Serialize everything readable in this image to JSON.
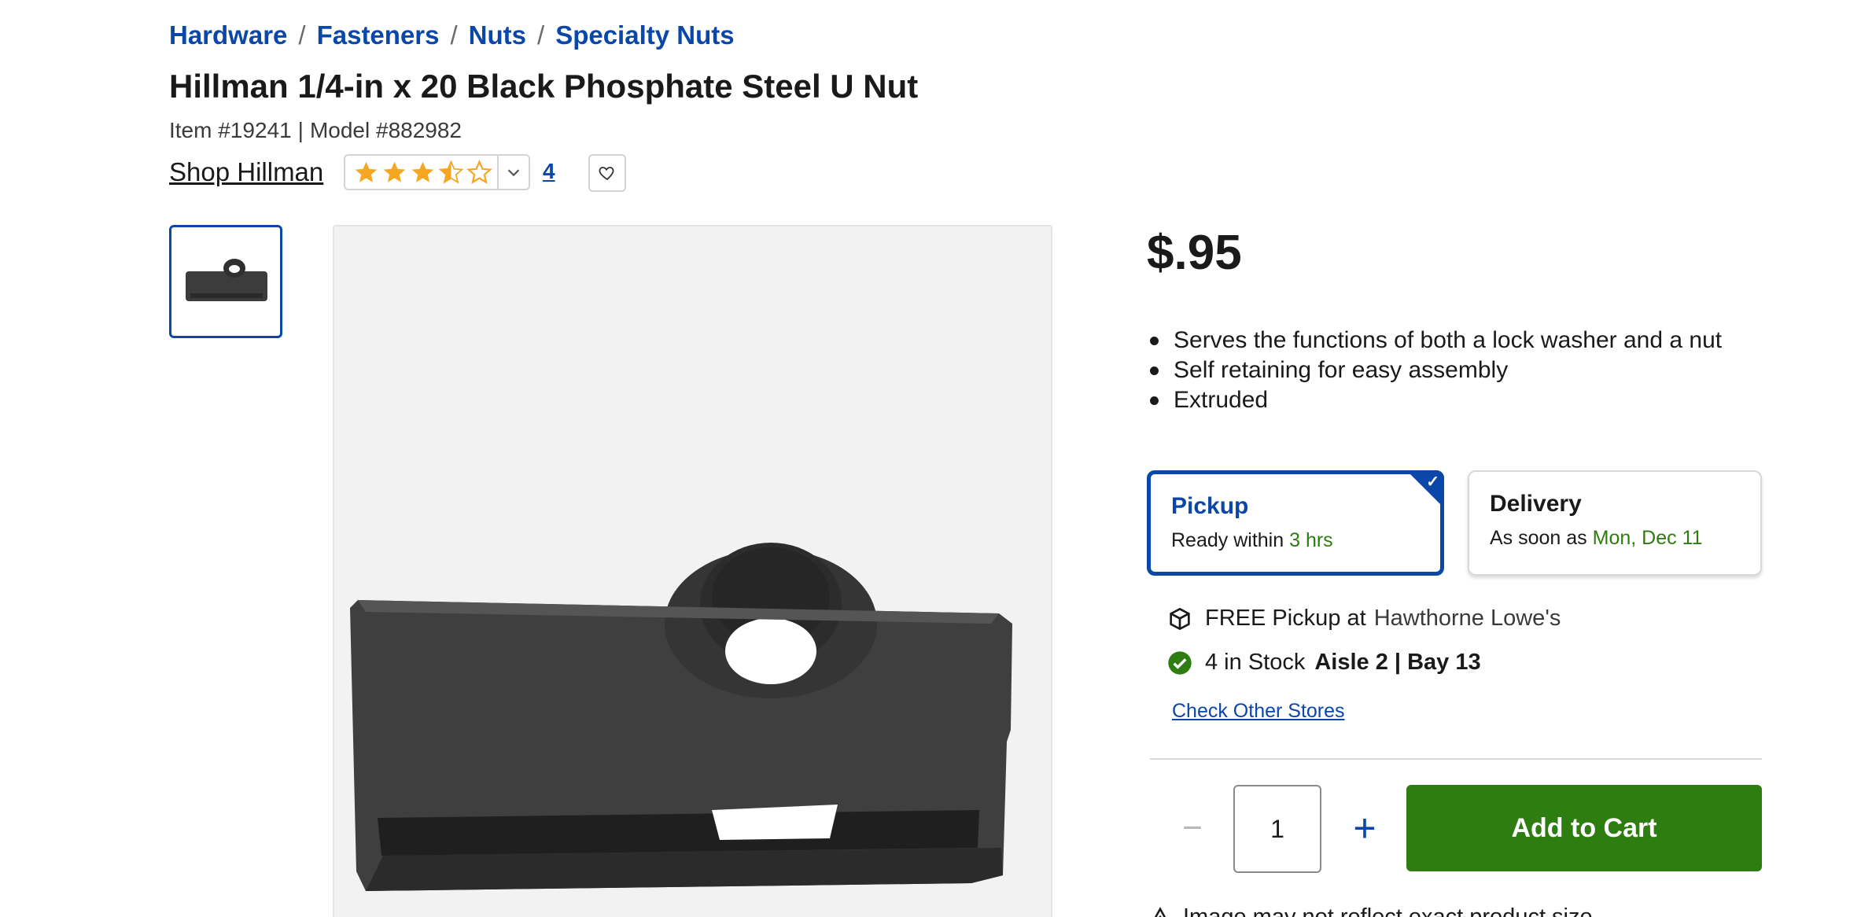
{
  "breadcrumb": {
    "items": [
      "Hardware",
      "Fasteners",
      "Nuts",
      "Specialty Nuts"
    ],
    "separator": "/"
  },
  "product": {
    "title": "Hillman 1/4-in x 20 Black Phosphate Steel U Nut",
    "item_number": "Item #19241",
    "meta_divider": "|",
    "model_number": "Model #882982",
    "shop_brand": "Shop Hillman",
    "rating": 3.5,
    "rating_max": 5,
    "review_count": "4",
    "price": "$.95",
    "features": [
      "Serves the functions of both a lock washer and a nut",
      "Self retaining for easy assembly",
      "Extruded"
    ]
  },
  "fulfillment": {
    "pickup": {
      "title": "Pickup",
      "sub_prefix": "Ready within",
      "sub_value": "3 hrs",
      "selected": true
    },
    "delivery": {
      "title": "Delivery",
      "sub_prefix": "As soon as",
      "sub_value": "Mon, Dec 11",
      "selected": false
    }
  },
  "store": {
    "pickup_text": "FREE Pickup at",
    "store_name": "Hawthorne Lowe's",
    "stock_text": "4 in Stock",
    "aisle_text": "Aisle 2 | Bay 13",
    "check_other": "Check Other Stores"
  },
  "cart": {
    "quantity": "1",
    "minus_label": "−",
    "plus_label": "+",
    "add_label": "Add to Cart"
  },
  "disclaimer": "Image may not reflect exact product size",
  "colors": {
    "link_blue": "#0a47a9",
    "success_green": "#2e7d10",
    "star_gold": "#f5a623"
  },
  "icons": {
    "wishlist": "heart-icon",
    "rating_toggle": "chevron-down-icon",
    "pickup": "box-icon",
    "stock": "check-circle-icon",
    "disclaimer": "warning-icon"
  }
}
